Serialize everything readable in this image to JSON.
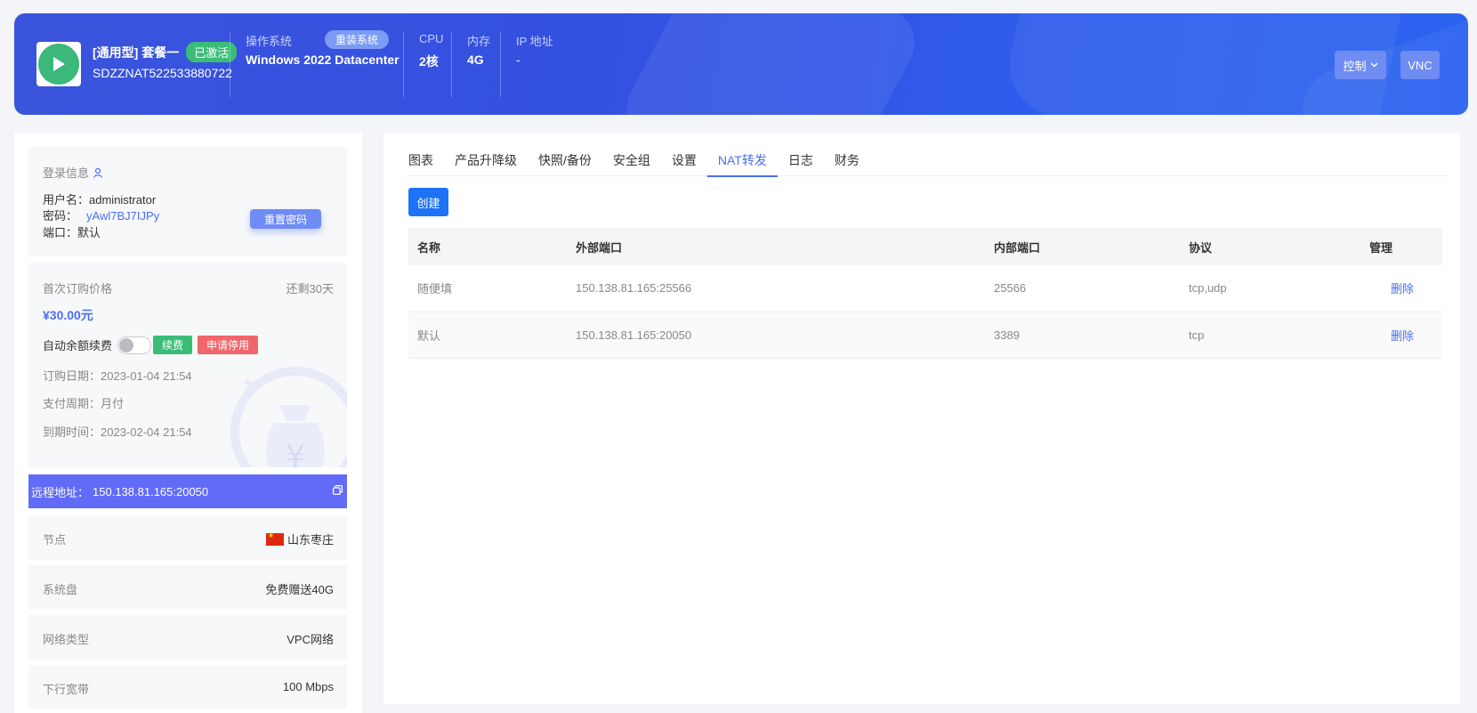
{
  "header": {
    "product_name": "[通用型] 套餐一",
    "status_badge": "已激活",
    "instance_id": "SDZZNAT522533880722",
    "os_label": "操作系统",
    "reinstall_label": "重装系统",
    "os_value": "Windows 2022 Datacenter",
    "cpu_label": "CPU",
    "cpu_value": "2核",
    "memory_label": "内存",
    "memory_value": "4G",
    "ip_label": "IP 地址",
    "ip_value": "-",
    "control_label": "控制",
    "vnc_label": "VNC",
    "accent_color": "#3450e0"
  },
  "login": {
    "title": "登录信息",
    "username_label": "用户名：",
    "username_value": "administrator",
    "password_label": "密码：",
    "password_value": "yAwl7BJ7IJPy",
    "port_label": "端口：",
    "port_value": "默认",
    "reset_password_label": "重置密码"
  },
  "billing": {
    "first_price_label": "首次订购价格",
    "remaining": "还剩30天",
    "price": "¥30.00元",
    "auto_renew_label": "自动余额续费",
    "auto_renew_on": false,
    "renew_label": "续费",
    "stop_label": "申请停用",
    "order_date_label": "订购日期：",
    "order_date": "2023-01-04 21:54",
    "pay_cycle_label": "支付周期：",
    "pay_cycle": "月付",
    "expire_label": "到期时间：",
    "expire_date": "2023-02-04 21:54"
  },
  "remote": {
    "label": "远程地址：",
    "address": "150.138.81.165:20050"
  },
  "specs": [
    {
      "key": "节点",
      "value": "山东枣庄",
      "flag": "cn"
    },
    {
      "key": "系统盘",
      "value": "免费赠送40G"
    },
    {
      "key": "网络类型",
      "value": "VPC网络"
    },
    {
      "key": "下行宽带",
      "value": "100 Mbps"
    }
  ],
  "tabs": [
    "图表",
    "产品升降级",
    "快照/备份",
    "安全组",
    "设置",
    "NAT转发",
    "日志",
    "财务"
  ],
  "active_tab": "NAT转发",
  "create_label": "创建",
  "nat_table": {
    "headers": [
      "名称",
      "外部端口",
      "内部端口",
      "协议",
      "管理"
    ],
    "rows": [
      {
        "name": "随便填",
        "external": "150.138.81.165:25566",
        "internal": "25566",
        "protocol": "tcp,udp",
        "action": "删除"
      },
      {
        "name": "默认",
        "external": "150.138.81.165:20050",
        "internal": "3389",
        "protocol": "tcp",
        "action": "删除"
      }
    ]
  }
}
